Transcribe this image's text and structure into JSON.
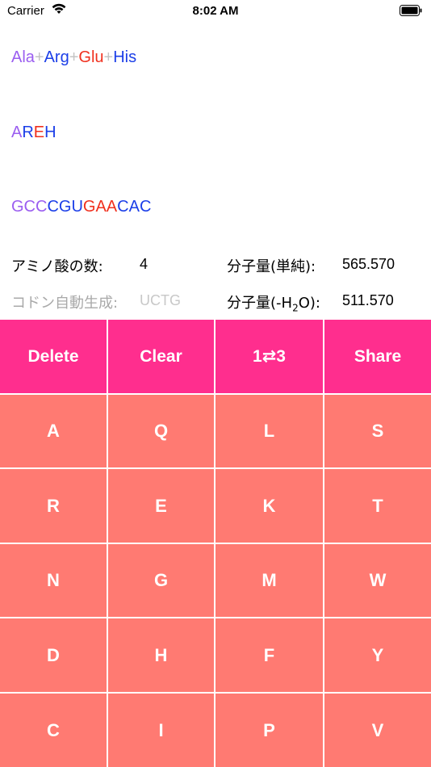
{
  "status_bar": {
    "carrier": "Carrier",
    "time": "8:02 AM"
  },
  "three_letter": [
    {
      "text": "Ala",
      "color": "#9b5ef0"
    },
    {
      "text": "+",
      "color": "#c4c4c4"
    },
    {
      "text": "Arg",
      "color": "#1c3fe8"
    },
    {
      "text": "+",
      "color": "#c4c4c4"
    },
    {
      "text": "Glu",
      "color": "#f0301e"
    },
    {
      "text": "+",
      "color": "#c4c4c4"
    },
    {
      "text": "His",
      "color": "#1c3fe8"
    }
  ],
  "one_letter": [
    {
      "text": "A",
      "color": "#9b5ef0"
    },
    {
      "text": "R",
      "color": "#1c3fe8"
    },
    {
      "text": "E",
      "color": "#f0301e"
    },
    {
      "text": "H",
      "color": "#1c3fe8"
    }
  ],
  "codons": [
    {
      "text": "GCC",
      "color": "#9b5ef0"
    },
    {
      "text": "CGU",
      "color": "#1c3fe8"
    },
    {
      "text": "GAA",
      "color": "#f0301e"
    },
    {
      "text": "CAC",
      "color": "#1c3fe8"
    }
  ],
  "info": {
    "count_label": "アミノ酸の数:",
    "count_value": "4",
    "mw_simple_label": "分子量(単純):",
    "mw_simple_value": "565.570",
    "codon_auto_label": "コドン自動生成:",
    "codon_auto_value": "UCTG",
    "mw_water_label_pre": "分子量(-H",
    "mw_water_label_sub": "2",
    "mw_water_label_post": "O):",
    "mw_water_value": "511.570"
  },
  "controls": {
    "delete": "Delete",
    "clear": "Clear",
    "toggle": "1⇄3",
    "share": "Share"
  },
  "keys": [
    [
      "A",
      "Q",
      "L",
      "S"
    ],
    [
      "R",
      "E",
      "K",
      "T"
    ],
    [
      "N",
      "G",
      "M",
      "W"
    ],
    [
      "D",
      "H",
      "F",
      "Y"
    ],
    [
      "C",
      "I",
      "P",
      "V"
    ]
  ],
  "colors": {
    "top_row": "#ff2e8e",
    "keys": "#ff7a72"
  }
}
